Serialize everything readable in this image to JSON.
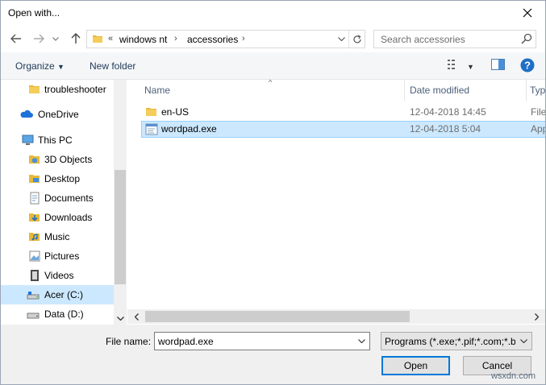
{
  "window": {
    "title": "Open with..."
  },
  "address": {
    "overflow": "«",
    "segments": [
      "windows nt",
      "accessories"
    ]
  },
  "search": {
    "placeholder": "Search accessories"
  },
  "toolbar": {
    "organize": "Organize",
    "new_folder": "New folder"
  },
  "nav": {
    "items": [
      {
        "label": "troubleshooter",
        "icon": "folder-icon"
      },
      {
        "label": "OneDrive",
        "icon": "onedrive-cloud-icon"
      },
      {
        "label": "This PC",
        "icon": "computer-icon"
      },
      {
        "label": "3D Objects",
        "icon": "3d-objects-icon"
      },
      {
        "label": "Desktop",
        "icon": "desktop-folder-icon"
      },
      {
        "label": "Documents",
        "icon": "documents-icon"
      },
      {
        "label": "Downloads",
        "icon": "downloads-icon"
      },
      {
        "label": "Music",
        "icon": "music-icon"
      },
      {
        "label": "Pictures",
        "icon": "pictures-icon"
      },
      {
        "label": "Videos",
        "icon": "videos-icon"
      },
      {
        "label": "Acer (C:)",
        "icon": "drive-c-icon"
      },
      {
        "label": "Data (D:)",
        "icon": "drive-d-icon"
      }
    ]
  },
  "files": {
    "columns": [
      "Name",
      "Date modified",
      "Typ"
    ],
    "rows": [
      {
        "name": "en-US",
        "date": "12-04-2018 14:45",
        "type": "File",
        "icon": "folder-icon"
      },
      {
        "name": "wordpad.exe",
        "date": "12-04-2018 5:04",
        "type": "App",
        "icon": "exe-app-icon"
      }
    ]
  },
  "bottom": {
    "filename_label": "File name:",
    "filename_value": "wordpad.exe",
    "filetype": "Programs (*.exe;*.pif;*.com;*.bat;*.cmd)",
    "open": "Open",
    "cancel": "Cancel"
  },
  "watermark": "wsxdn.com",
  "colors": {
    "selection": "#cce8ff",
    "accent": "#0078d7",
    "folder": "#e8b839"
  }
}
